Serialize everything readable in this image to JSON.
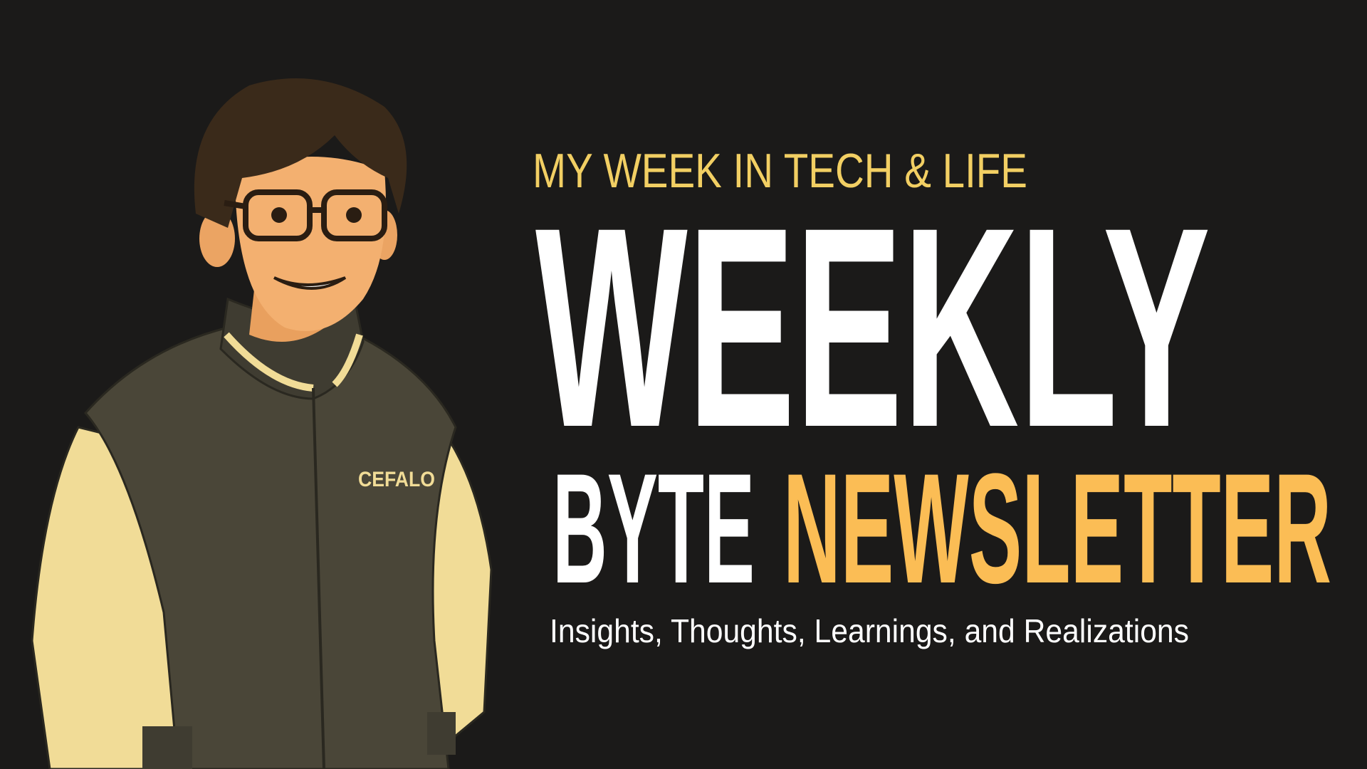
{
  "banner": {
    "kicker": "MY WEEK IN TECH & LIFE",
    "title_line1": "WEEKLY",
    "title_word_a": "BYTE",
    "title_word_b": "NEWSLETTER",
    "subtitle": "Insights, Thoughts, Learnings, and Realizations"
  },
  "illustration": {
    "subject": "cartoon-man-with-glasses-in-varsity-jacket",
    "jacket_lettering": "CEFALO"
  },
  "colors": {
    "background": "#1b1a19",
    "kicker": "#f2cf63",
    "title": "#ffffff",
    "accent": "#fbbd55",
    "subtitle": "#ffffff",
    "jacket": "#4a4638",
    "sleeves": "#f1dc97"
  }
}
